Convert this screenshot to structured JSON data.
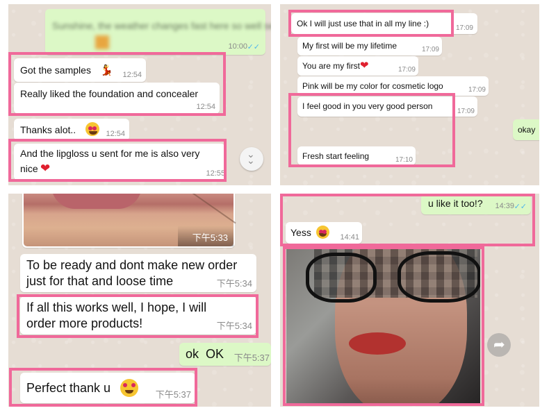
{
  "panel_tl": {
    "blurred_text": "Sunshine, the weather changes fast here so well see",
    "blurred_time": "10:00",
    "msg1": {
      "text": "Got the samples",
      "time": "12:54"
    },
    "msg2": {
      "text": "Really liked the foundation and concealer",
      "time": "12:54"
    },
    "msg3": {
      "text": "Thanks alot..",
      "time": "12:54"
    },
    "msg4": {
      "line1": "And the lipgloss u sent for me is also very",
      "line2": "nice",
      "time": "12:55"
    },
    "scroll_icon": "chevron-down-double"
  },
  "panel_tr": {
    "msg1": {
      "text": "Ok I will just use that in all my line :)",
      "time": "17:09"
    },
    "msg2": {
      "text": "My first will be my lifetime",
      "time": "17:09"
    },
    "msg3": {
      "text": "You are my first",
      "time": "17:09"
    },
    "msg4": {
      "text": "Pink will be my color for cosmetic logo",
      "time": "17:09"
    },
    "msg5": {
      "text": "I feel good in you very good person",
      "time": "17:09"
    },
    "msg6": {
      "text": "okay"
    },
    "msg7": {
      "text": "Fresh start feeling",
      "time": "17:10"
    }
  },
  "panel_bl": {
    "photo_time": "下午5:33",
    "msg1": {
      "line1": "To be ready and dont make new order",
      "line2": "just for that and loose time",
      "time": "下午5:34"
    },
    "msg2": {
      "line1": "If all this works well, I hope, I will",
      "line2": "order more products!",
      "time": "下午5:34"
    },
    "msg3": {
      "text": "ok  OK",
      "time": "下午5:37"
    },
    "msg4": {
      "text": "Perfect thank u",
      "time": "下午5:37"
    }
  },
  "panel_br": {
    "msg1": {
      "text": "u like it too!?",
      "time": "14:39"
    },
    "msg2": {
      "text": "Yess",
      "time": "14:41"
    },
    "share_icon": "share-arrow"
  },
  "colors": {
    "highlight": "#f0699a",
    "outgoing": "#dcf8c6",
    "incoming": "#ffffff",
    "wallpaper": "#e6ddd4",
    "tick": "#4fb6ec"
  }
}
